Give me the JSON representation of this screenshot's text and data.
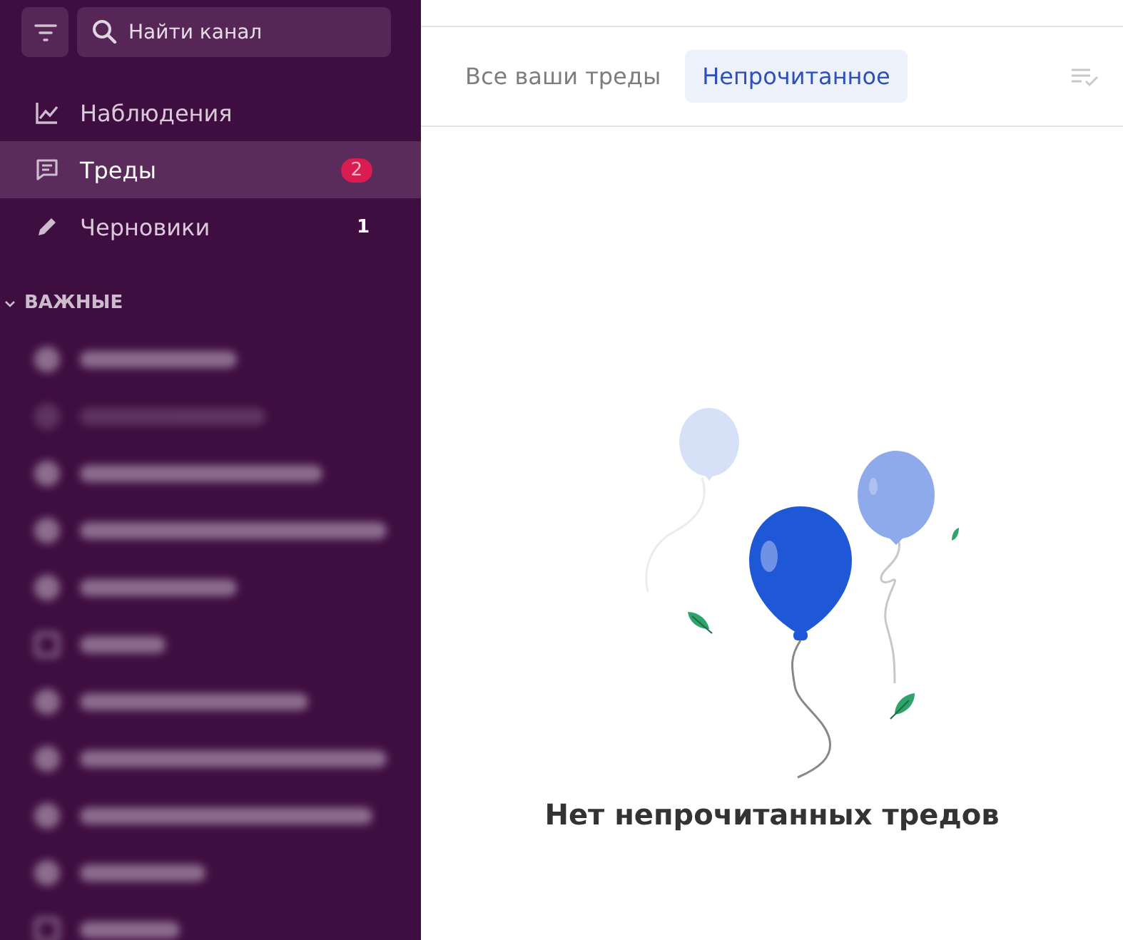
{
  "sidebar": {
    "search": {
      "placeholder": "Найти канал"
    },
    "nav_items": [
      {
        "label": "Наблюдения",
        "selected": false
      },
      {
        "label": "Треды",
        "selected": true,
        "counter": {
          "kind": "mention",
          "text": "2"
        }
      },
      {
        "label": "Черновики",
        "selected": false,
        "counter": {
          "kind": "plain",
          "text": "1"
        }
      }
    ],
    "section": {
      "title": "ВАЖНЫЕ",
      "expanded": true
    }
  },
  "tabs": [
    {
      "label": "Все ваши треды",
      "selected": false
    },
    {
      "label": "Непрочитанное",
      "selected": true
    }
  ],
  "empty_state": {
    "title": "Нет непрочитанных тредов"
  }
}
